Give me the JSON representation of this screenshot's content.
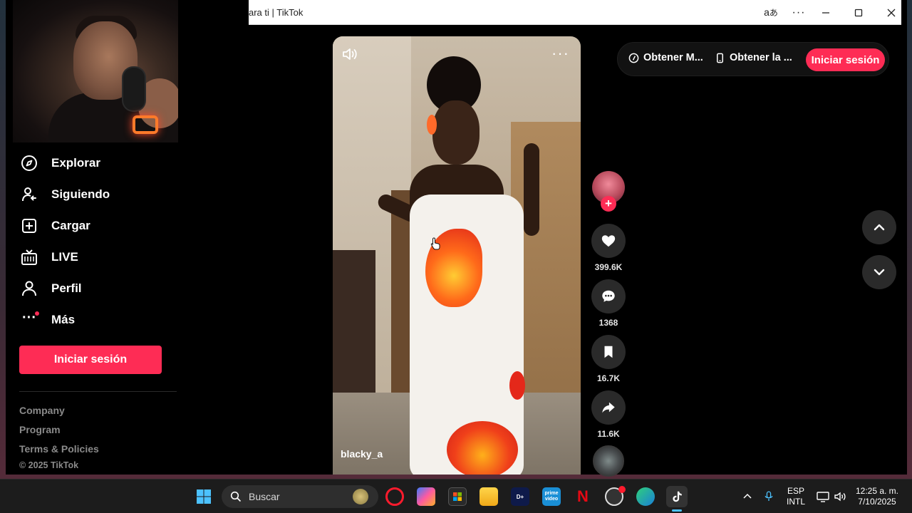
{
  "window": {
    "title": "ara ti | TikTok",
    "translate_icon": "translate-icon",
    "more_icon": "ellipsis-icon"
  },
  "sidebar": {
    "items": [
      {
        "label": "Explorar",
        "icon": "compass-icon"
      },
      {
        "label": "Siguiendo",
        "icon": "user-follow-icon"
      },
      {
        "label": "Cargar",
        "icon": "upload-plus-icon"
      },
      {
        "label": "LIVE",
        "icon": "live-tv-icon"
      },
      {
        "label": "Perfil",
        "icon": "user-icon"
      },
      {
        "label": "Más",
        "icon": "more-dots-icon"
      }
    ],
    "login_label": "Iniciar sesión",
    "footer_links": [
      "Company",
      "Program",
      "Terms & Policies"
    ],
    "copyright": "© 2025 TikTok"
  },
  "video": {
    "username": "blacky_a",
    "likes": "399.6K",
    "comments": "1368",
    "saves": "16.7K",
    "shares": "11.6K"
  },
  "topbar": {
    "link1": "Obtener M...",
    "link2": "Obtener la ...",
    "login_label": "Iniciar sesión"
  },
  "taskbar": {
    "search_placeholder": "Buscar",
    "lang_top": "ESP",
    "lang_bottom": "INTL",
    "time": "12:25 a. m.",
    "date": "7/10/2025"
  },
  "colors": {
    "accent": "#fe2c55",
    "background": "#000000",
    "action_button": "#2a2a2a"
  }
}
